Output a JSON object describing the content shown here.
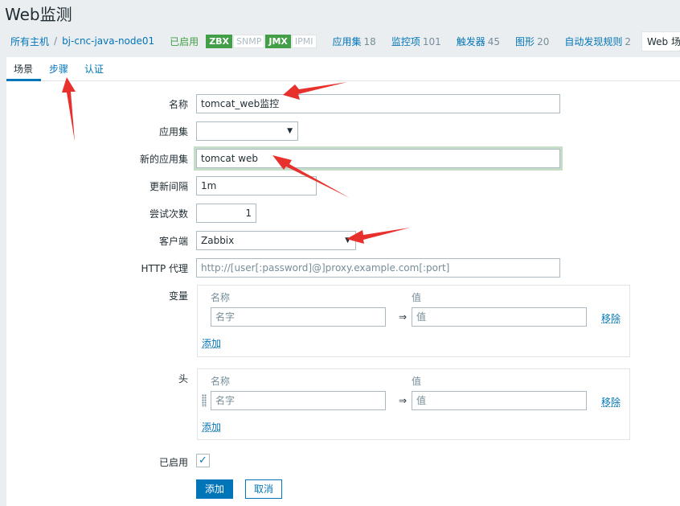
{
  "page": {
    "title": "Web监测"
  },
  "hostnav": {
    "all_hosts": "所有主机",
    "separator": "/",
    "host": "bj-cnc-java-node01",
    "status": "已启用",
    "badges": [
      {
        "label": "ZBX",
        "state": "on"
      },
      {
        "label": "SNMP",
        "state": "off"
      },
      {
        "label": "JMX",
        "state": "on"
      },
      {
        "label": "IPMI",
        "state": "off"
      }
    ],
    "items": [
      {
        "label": "应用集",
        "count": "18"
      },
      {
        "label": "监控项",
        "count": "101"
      },
      {
        "label": "触发器",
        "count": "45"
      },
      {
        "label": "图形",
        "count": "20"
      },
      {
        "label": "自动发现规则",
        "count": "2"
      }
    ],
    "active": "Web 场景"
  },
  "tabs": {
    "scenario": "场景",
    "steps": "步骤",
    "auth": "认证"
  },
  "form": {
    "name_label": "名称",
    "name_value": "tomcat_web监控",
    "app_label": "应用集",
    "app_value": "",
    "new_app_label": "新的应用集",
    "new_app_value": "tomcat web",
    "interval_label": "更新间隔",
    "interval_value": "1m",
    "attempts_label": "尝试次数",
    "attempts_value": "1",
    "agent_label": "客户端",
    "agent_value": "Zabbix",
    "proxy_label": "HTTP 代理",
    "proxy_placeholder": "http://[user[:password]@]proxy.example.com[:port]",
    "variables_label": "变量",
    "headers_label": "头",
    "enabled_label": "已启用"
  },
  "variables": {
    "col_name": "名称",
    "col_value": "值",
    "name_placeholder": "名字",
    "value_placeholder": "值",
    "arrow": "⇒",
    "remove": "移除",
    "add": "添加"
  },
  "headers": {
    "col_name": "名称",
    "col_value": "值",
    "name_placeholder": "名字",
    "value_placeholder": "值",
    "arrow": "⇒",
    "remove": "移除",
    "add": "添加"
  },
  "buttons": {
    "add": "添加",
    "cancel": "取消"
  },
  "colors": {
    "link": "#0275b8",
    "enabled": "#429e47",
    "annotation": "#e8302c"
  }
}
